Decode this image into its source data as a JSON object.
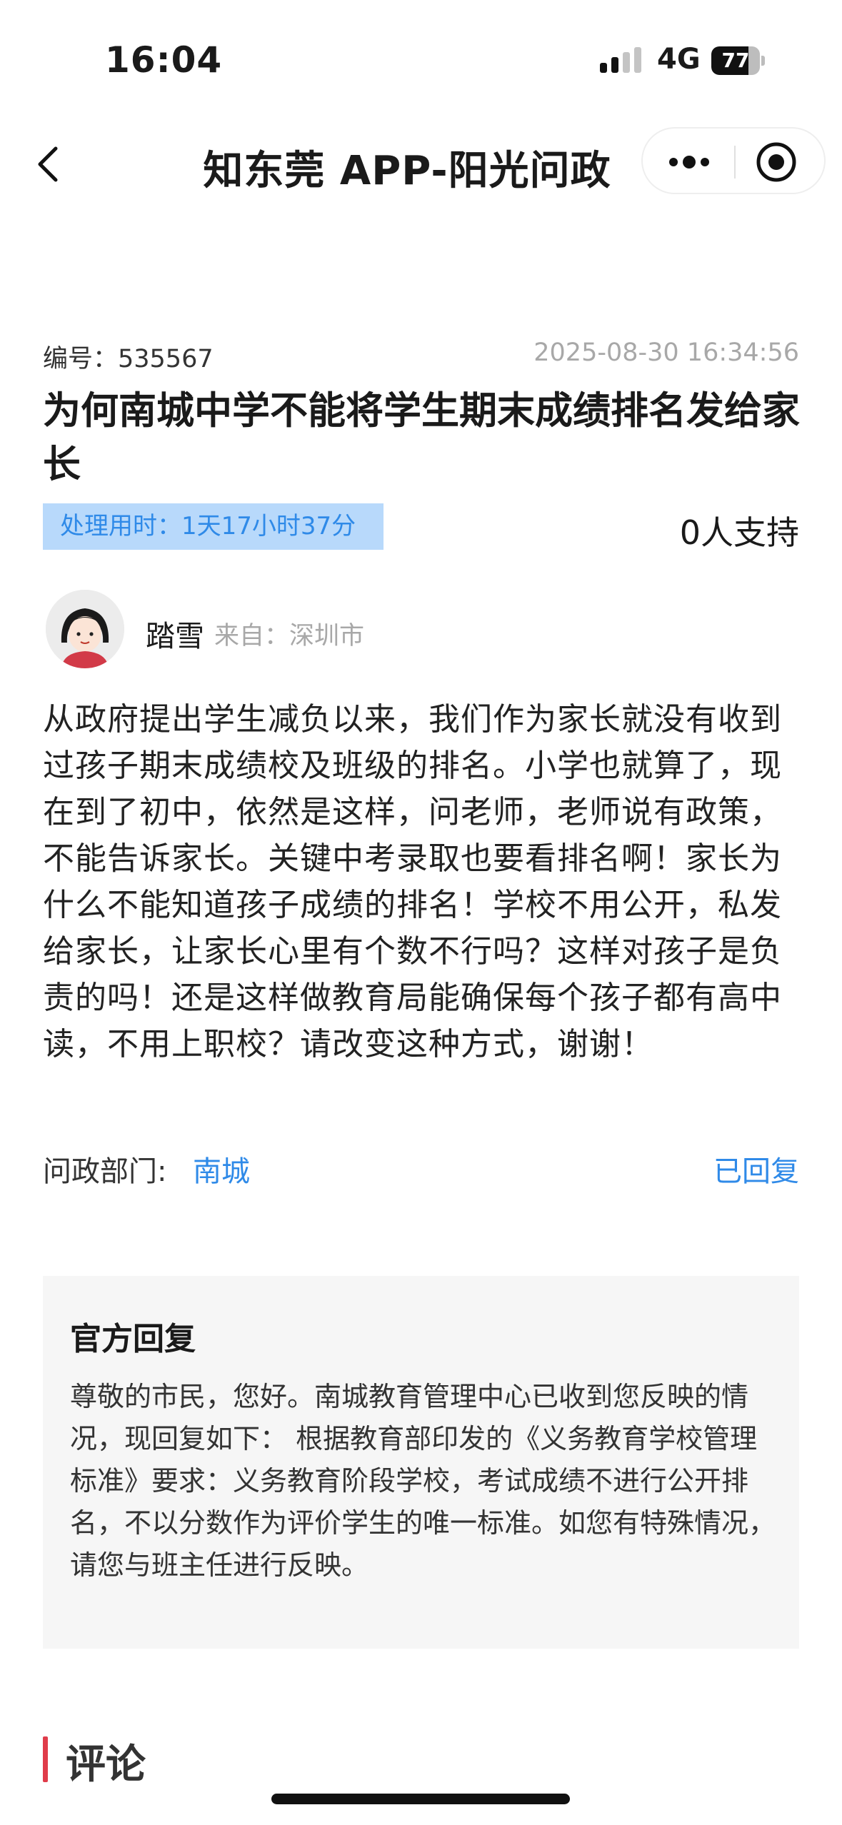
{
  "status_bar": {
    "time": "16:04",
    "network": "4G",
    "battery": "77",
    "battery_level": 0.77
  },
  "nav": {
    "title": "知东莞 APP-阳光问政"
  },
  "post": {
    "code": "编号：535567",
    "date": "2025-08-30 16:34:56",
    "title": "为何南城中学不能将学生期末成绩排名发给家长",
    "processing_time": "处理用时：1天17小时37分",
    "support": "0人支持",
    "author_name": "踏雪",
    "author_from": "来自：深圳市",
    "content": "从政府提出学生减负以来，我们作为家长就没有收到过孩子期末成绩校及班级的排名。小学也就算了，现在到了初中，依然是这样，问老师，老师说有政策，不能告诉家长。关键中考录取也要看排名啊！家长为什么不能知道孩子成绩的排名！学校不用公开，私发给家长，让家长心里有个数不行吗？这样对孩子是负责的吗！还是这样做教育局能确保每个孩子都有高中读，不用上职校？请改变这种方式，谢谢！",
    "dept_label": "问政部门:",
    "dept_value": "南城",
    "reply_status": "已回复"
  },
  "reply": {
    "title": "官方回复",
    "text": "尊敬的市民，您好。南城教育管理中心已收到您反映的情况，现回复如下： 根据教育部印发的《义务教育学校管理标准》要求：义务教育阶段学校，考试成绩不进行公开排名，不以分数作为评价学生的唯一标准。如您有特殊情况，请您与班主任进行反映。"
  },
  "comments": {
    "title": "评论"
  },
  "colors": {
    "accent_blue": "#2f8ae8",
    "tag_bg": "#b8d9fb",
    "comment_bar": "#e03c4a"
  }
}
